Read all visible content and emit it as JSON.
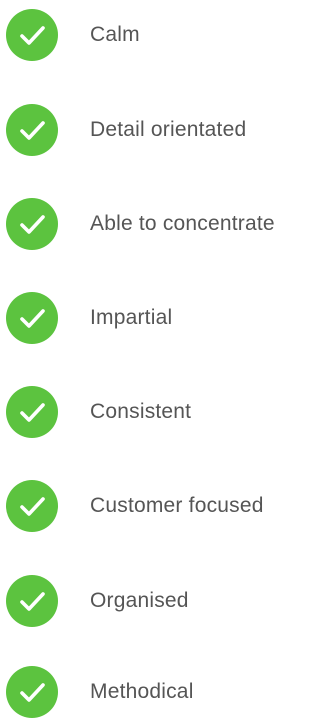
{
  "checklist": {
    "icon": "check-circle-icon",
    "icon_color": "#5cc33f",
    "text_color": "#555555",
    "items": [
      {
        "label": "Calm"
      },
      {
        "label": "Detail orientated"
      },
      {
        "label": "Able to concentrate"
      },
      {
        "label": "Impartial"
      },
      {
        "label": "Consistent"
      },
      {
        "label": "Customer focused"
      },
      {
        "label": "Organised"
      },
      {
        "label": "Methodical"
      }
    ]
  }
}
